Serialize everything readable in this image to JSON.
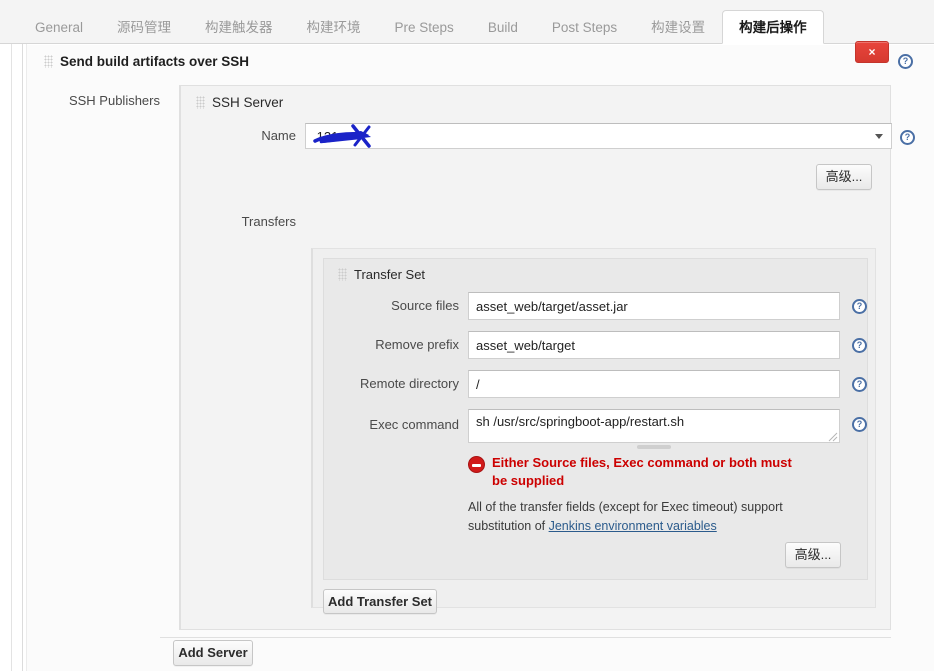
{
  "tabs": [
    {
      "label": "General",
      "active": false
    },
    {
      "label": "源码管理",
      "active": false
    },
    {
      "label": "构建触发器",
      "active": false
    },
    {
      "label": "构建环境",
      "active": false
    },
    {
      "label": "Pre Steps",
      "active": false
    },
    {
      "label": "Build",
      "active": false
    },
    {
      "label": "Post Steps",
      "active": false
    },
    {
      "label": "构建设置",
      "active": false
    },
    {
      "label": "构建后操作",
      "active": true
    }
  ],
  "publisher": {
    "title": "Send build artifacts over SSH",
    "grip_icon": "drag-handle-icon",
    "delete_label": "×",
    "delete_icon": "close-x-icon",
    "help_icon": "help-question-icon"
  },
  "ssh_publishers": {
    "label": "SSH Publishers",
    "server_section": {
      "title": "SSH Server",
      "grip_icon": "drag-handle-icon",
      "name_label": "Name",
      "name_value": ".121",
      "name_placeholder": "",
      "dropdown_icon": "chevron-down-icon",
      "redaction_note": "redacted-scribble",
      "redaction_color": "#1a23c8",
      "advanced_label": "高级..."
    }
  },
  "transfers": {
    "label": "Transfers",
    "transfer_set": {
      "title": "Transfer Set",
      "grip_icon": "drag-handle-icon",
      "fields": [
        {
          "label": "Source files",
          "value": "asset_web/target/asset.jar",
          "help_icon": "help-question-icon"
        },
        {
          "label": "Remove prefix",
          "value": "asset_web/target",
          "help_icon": "help-question-icon"
        },
        {
          "label": "Remote directory",
          "value": "/",
          "help_icon": "help-question-icon"
        }
      ],
      "exec": {
        "label": "Exec command",
        "value": "sh /usr/src/springboot-app/restart.sh",
        "help_icon": "help-question-icon"
      },
      "error": {
        "icon": "error-stop-icon",
        "text": "Either Source files, Exec command or both must be supplied",
        "color": "#cc0000"
      },
      "hint": {
        "text_before": "All of the transfer fields (except for Exec timeout) support substitution of ",
        "link_text": "Jenkins environment variables"
      },
      "advanced_label": "高级..."
    },
    "add_transfer_set_label": "Add Transfer Set"
  },
  "footer": {
    "add_server_label": "Add Server"
  },
  "colors": {
    "accent_help": "#4a6fa5",
    "error": "#cc0000",
    "delete_button": "#d63a30",
    "link": "#2b5b8c",
    "panel_bg": "#f3f3f3"
  }
}
